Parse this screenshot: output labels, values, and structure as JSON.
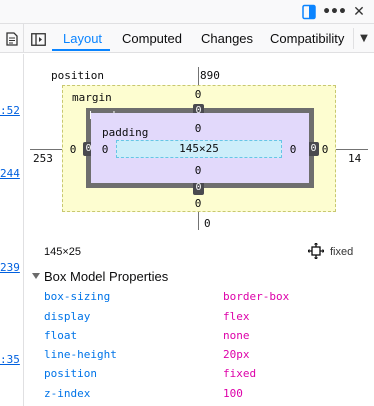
{
  "toolbar": {
    "dock_icon": "dock-side-icon",
    "more_icon": "more-options-icon",
    "more_glyph": "•••",
    "close_icon": "close-icon",
    "close_glyph": "✕"
  },
  "tabs": {
    "items": [
      {
        "label": "Layout",
        "selected": true
      },
      {
        "label": "Computed",
        "selected": false
      },
      {
        "label": "Changes",
        "selected": false
      },
      {
        "label": "Compatibility",
        "selected": false
      }
    ],
    "overflow_icon": "chevron-down-icon",
    "overflow_glyph": "▼"
  },
  "gutter": {
    "links": [
      ":52",
      "244",
      "239",
      ":35"
    ]
  },
  "box_model": {
    "position_label": "position",
    "position_top": "890",
    "position_left": "253",
    "position_right": "14",
    "position_bottom": "0",
    "margin_label": "margin",
    "margin_top": "0",
    "margin_left": "0",
    "margin_right": "0",
    "margin_bottom": "0",
    "border_label": "border",
    "border_top": "0",
    "border_left": "0",
    "border_right": "0",
    "border_bottom": "0",
    "padding_label": "padding",
    "padding_top": "0",
    "padding_left": "0",
    "padding_right": "0",
    "padding_bottom": "0",
    "content_size": "145×25"
  },
  "element_info": {
    "size": "145×25",
    "position_icon": "crosshair-icon",
    "position_type": "fixed"
  },
  "properties": {
    "title": "Box Model Properties",
    "rows": [
      {
        "name": "box-sizing",
        "value": "border-box"
      },
      {
        "name": "display",
        "value": "flex"
      },
      {
        "name": "float",
        "value": "none"
      },
      {
        "name": "line-height",
        "value": "20px"
      },
      {
        "name": "position",
        "value": "fixed"
      },
      {
        "name": "z-index",
        "value": "100"
      }
    ]
  },
  "colors": {
    "accent": "#0a84ff",
    "margin_fill": "#fdfdd0",
    "border_fill": "#6e6e6e",
    "padding_fill": "#e2d9fb",
    "content_fill": "#cdeefa",
    "prop_name": "#0074e8",
    "prop_value": "#dd00a9"
  }
}
